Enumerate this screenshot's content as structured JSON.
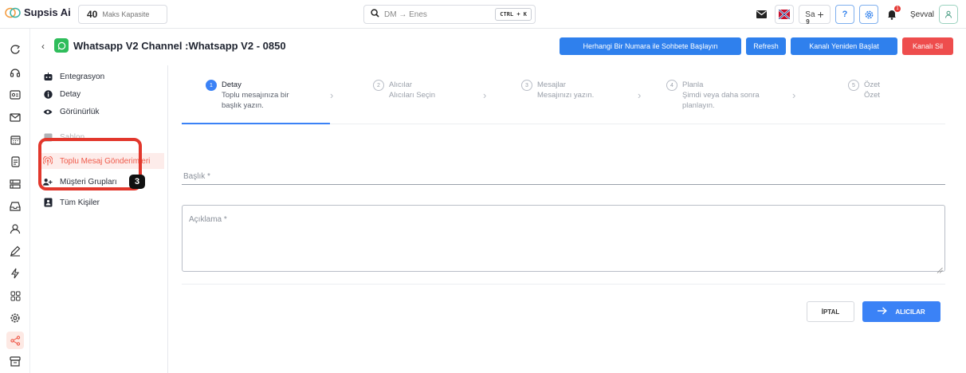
{
  "topbar": {
    "brand": "Supsis Ai",
    "capacity_value": "40",
    "capacity_label": "Maks Kapasite",
    "search_placeholder": "DM → Enes",
    "search_shortcut": "CTRL + K",
    "lang_label": "Sa",
    "lang_number": "9",
    "user_name": "Şevval",
    "notification_count": "1",
    "accent_color": "#2f80ed",
    "danger_color": "#ee4d4d"
  },
  "rail": {
    "icons": [
      "share-icon",
      "headset-icon",
      "id-card-icon",
      "mail-icon",
      "calendar-icon",
      "document-icon",
      "layers-icon",
      "inbox-icon",
      "user-search-icon",
      "edit-icon",
      "flash-icon",
      "grid-icon",
      "settings-icon",
      "share-nodes-icon",
      "archive-icon"
    ],
    "active_color": "#ef5a4a"
  },
  "channel": {
    "title": "Whatsapp V2 Channel :Whatsapp V2 - 0850",
    "buttons": {
      "start_chat": "Herhangi Bir Numara ile Sohbete Başlayın",
      "refresh": "Refresh",
      "restart": "Kanalı Yeniden Başlat",
      "delete": "Kanalı Sil"
    }
  },
  "subsidebar": {
    "items": [
      {
        "label": "Entegrasyon",
        "icon": "robot-icon"
      },
      {
        "label": "Detay",
        "icon": "info-icon"
      },
      {
        "label": "Görünürlük",
        "icon": "eye-icon"
      },
      {
        "label": "Şablon",
        "icon": "template-icon"
      },
      {
        "label": "Toplu Mesaj Gönderimleri",
        "icon": "broadcast-icon"
      },
      {
        "label": "Müşteri Grupları",
        "icon": "user-group-icon"
      },
      {
        "label": "Tüm Kişiler",
        "icon": "contacts-icon"
      }
    ],
    "callout_badge": "3"
  },
  "stepper": {
    "steps": [
      {
        "num": "1",
        "title": "Detay",
        "subtitle": "Toplu mesajınıza bir başlık yazın."
      },
      {
        "num": "2",
        "title": "Alıcılar",
        "subtitle": "Alıcıları Seçin"
      },
      {
        "num": "3",
        "title": "Mesajlar",
        "subtitle": "Mesajınızı yazın."
      },
      {
        "num": "4",
        "title": "Planla",
        "subtitle": "Şimdi veya daha sonra planlayın."
      },
      {
        "num": "5",
        "title": "Özet",
        "subtitle": "Özet"
      }
    ]
  },
  "form": {
    "title_label": "Başlık *",
    "description_label": "Açıklama *",
    "cancel_label": "İPTAL",
    "next_label": "ALICILAR"
  }
}
